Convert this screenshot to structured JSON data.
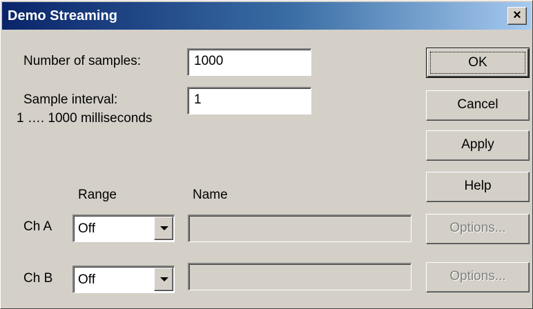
{
  "window": {
    "title": "Demo Streaming",
    "close_glyph": "×"
  },
  "form": {
    "samples_label": "Number of samples:",
    "samples_value": "1000",
    "interval_label": "Sample interval:",
    "interval_hint": "1 …. 1000 milliseconds",
    "interval_value": "1"
  },
  "channels": {
    "range_header": "Range",
    "name_header": "Name",
    "rows": [
      {
        "label": "Ch A",
        "range": "Off",
        "name": "",
        "options_label": "Options..."
      },
      {
        "label": "Ch B",
        "range": "Off",
        "name": "",
        "options_label": "Options..."
      }
    ]
  },
  "buttons": {
    "ok": "OK",
    "cancel": "Cancel",
    "apply": "Apply",
    "help": "Help"
  },
  "colors": {
    "face": "#d4d0c8",
    "title_start": "#0a246a",
    "title_end": "#a6caf0",
    "disabled_text": "#808080"
  }
}
